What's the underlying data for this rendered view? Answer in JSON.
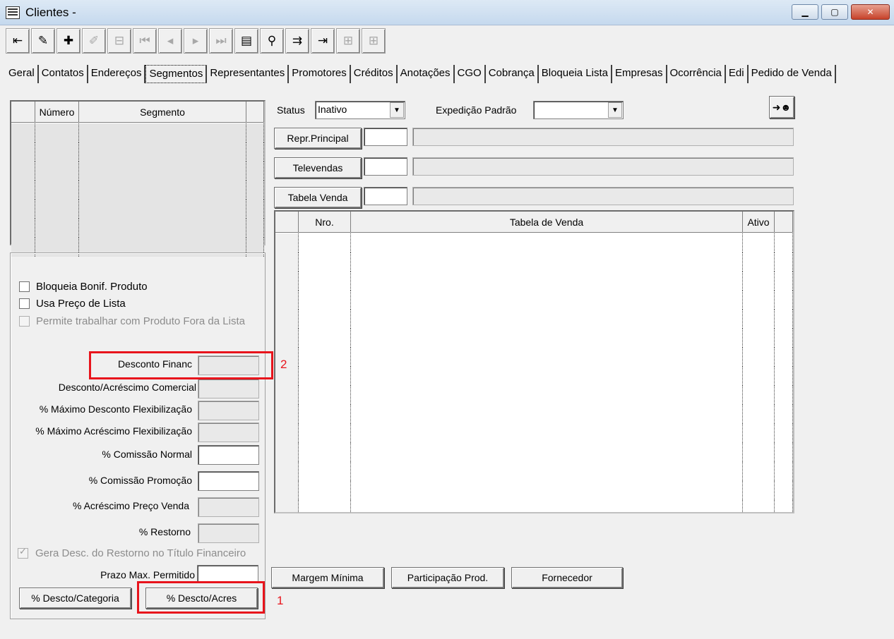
{
  "window": {
    "title": "Clientes -",
    "min_icon": "minimize-icon",
    "max_icon": "maximize-icon",
    "close_icon": "close-icon"
  },
  "toolbar": [
    {
      "icon": "exit-door-icon",
      "glyph": "⇤",
      "enabled": true
    },
    {
      "icon": "eraser-icon",
      "glyph": "✎",
      "enabled": true
    },
    {
      "icon": "add-record-icon",
      "glyph": "✚",
      "enabled": true
    },
    {
      "icon": "edit-record-icon",
      "glyph": "✐",
      "enabled": false
    },
    {
      "icon": "remove-record-icon",
      "glyph": "⊟",
      "enabled": false
    },
    {
      "icon": "first-record-icon",
      "glyph": "⏮",
      "enabled": false
    },
    {
      "icon": "prev-record-icon",
      "glyph": "◂",
      "enabled": false
    },
    {
      "icon": "next-record-icon",
      "glyph": "▸",
      "enabled": false
    },
    {
      "icon": "last-record-icon",
      "glyph": "⏭",
      "enabled": false
    },
    {
      "icon": "list-icon",
      "glyph": "▤",
      "enabled": true
    },
    {
      "icon": "binoculars-icon",
      "glyph": "⚲",
      "enabled": true
    },
    {
      "icon": "import-icon",
      "glyph": "⇉",
      "enabled": true
    },
    {
      "icon": "export-icon",
      "glyph": "⇥",
      "enabled": true
    },
    {
      "icon": "grid-disabled-icon",
      "glyph": "⊞",
      "enabled": false
    },
    {
      "icon": "grid-disabled-2-icon",
      "glyph": "⊞",
      "enabled": false
    }
  ],
  "tabs": [
    "Geral",
    "Contatos",
    "Endereços",
    "Segmentos",
    "Representantes",
    "Promotores",
    "Créditos",
    "Anotações",
    "CGO",
    "Cobrança",
    "Bloqueia Lista",
    "Empresas",
    "Ocorrência",
    "Edi",
    "Pedido de Venda"
  ],
  "active_tab": "Segmentos",
  "segment_grid": {
    "col_numero": "Número",
    "col_segmento": "Segmento",
    "rows": 7
  },
  "checkboxes": {
    "bloqueia": "Bloqueia Bonif. Produto",
    "usa_preco": "Usa Preço de Lista",
    "permite": "Permite trabalhar com Produto Fora da Lista",
    "gera_desc": "Gera Desc. do Restorno no Título Financeiro"
  },
  "fields": {
    "desconto_financ": "Desconto Financ",
    "desc_acresc_com": "Desconto/Acréscimo Comercial",
    "max_desc_flex": "% Máximo Desconto Flexibilização",
    "max_acresc_flex": "% Máximo Acréscimo Flexibilização",
    "comissao_normal": "% Comissão Normal",
    "comissao_promo": "% Comissão Promoção",
    "acresc_preco": "% Acréscimo Preço Venda",
    "restorno": "% Restorno",
    "prazo_max": "Prazo Max. Permitido"
  },
  "buttons": {
    "desc_categoria": "% Descto/Categoria",
    "desc_acres": "% Descto/Acres",
    "margem": "Margem Mínima",
    "participacao": "Participação Prod.",
    "fornecedor": "Fornecedor",
    "repr_principal": "Repr.Principal",
    "televendas": "Televendas",
    "tabela_venda": "Tabela Venda"
  },
  "status": {
    "label": "Status",
    "value": "Inativo"
  },
  "expedicao": {
    "label": "Expedição Padrão",
    "value": ""
  },
  "tabela_grid": {
    "col_nro": "Nro.",
    "col_tabela": "Tabela de Venda",
    "col_ativo": "Ativo",
    "rows": 15
  },
  "annotations": {
    "one": "1",
    "two": "2"
  }
}
